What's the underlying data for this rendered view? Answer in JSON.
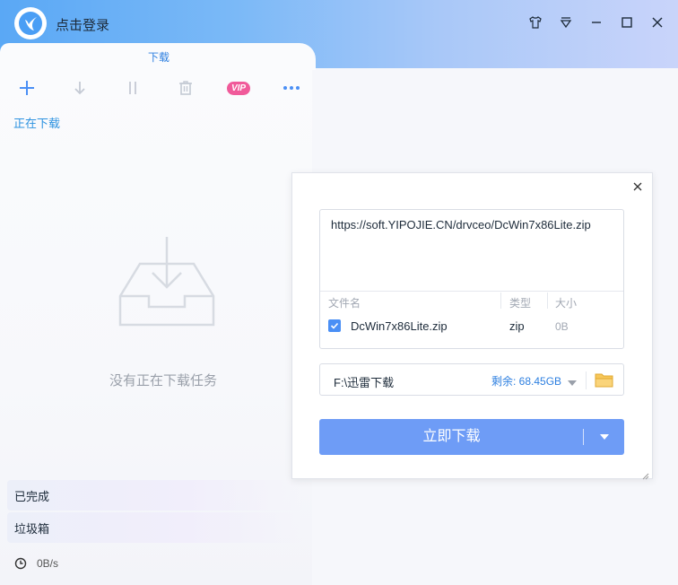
{
  "title_bar": {
    "login_text": "点击登录"
  },
  "tabs": [
    {
      "label": "下载"
    }
  ],
  "toolbar": {
    "vip_label": "VIP"
  },
  "sidebar": {
    "downloading": "正在下载",
    "completed": "已完成",
    "trash": "垃圾箱"
  },
  "empty_state": {
    "message": "没有正在下载任务"
  },
  "status": {
    "speed": "0B/s"
  },
  "dialog": {
    "url": "https://soft.YIPOJIE.CN/drvceo/DcWin7x86Lite.zip",
    "columns": [
      "文件名",
      "类型",
      "大小"
    ],
    "files": [
      {
        "name": "DcWin7x86Lite.zip",
        "type": "zip",
        "size": "0B",
        "checked": true
      }
    ],
    "save_path": "F:\\迅雷下载",
    "free_space": "剩余: 68.45GB",
    "download_button": "立即下载"
  },
  "colors": {
    "accent": "#6e9cf6",
    "link": "#2d7fe0",
    "vip": "#f05a9a"
  }
}
